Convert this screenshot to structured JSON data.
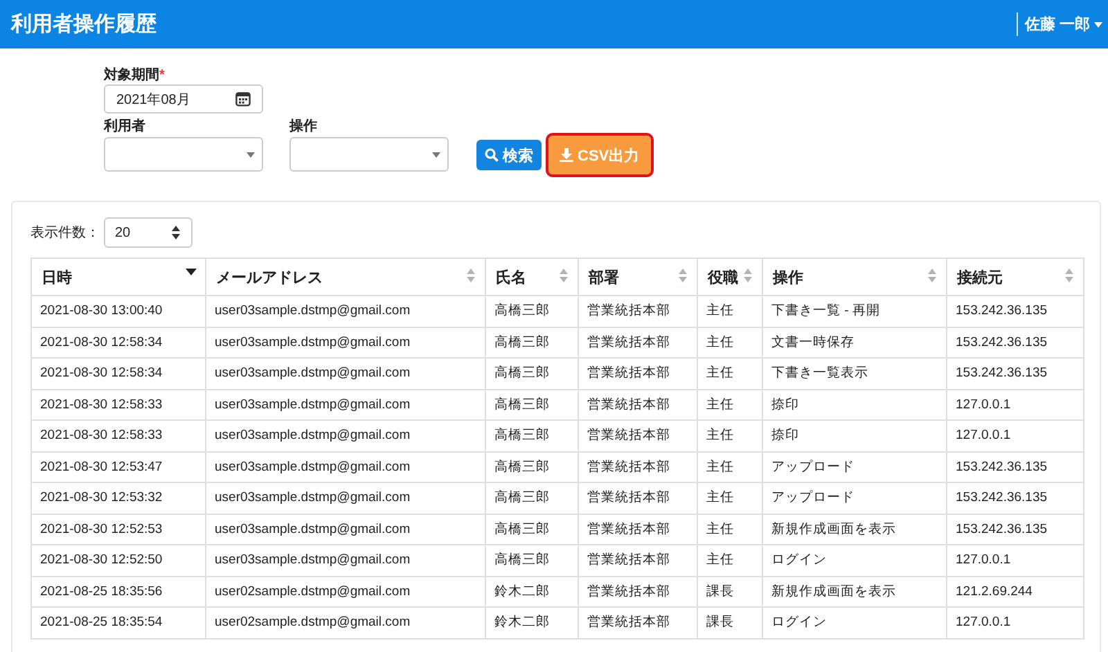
{
  "header": {
    "title": "利用者操作履歴",
    "user": "佐藤 一郎"
  },
  "filters": {
    "period": {
      "label": "対象期間",
      "required_mark": "*",
      "value": "2021年08月"
    },
    "user": {
      "label": "利用者"
    },
    "operation": {
      "label": "操作"
    },
    "buttons": [
      {
        "label": "検索",
        "kind": "search",
        "highlighted": false
      },
      {
        "label": "CSV出力",
        "kind": "download",
        "highlighted": true
      }
    ]
  },
  "page_size": {
    "label": "表示件数：",
    "value": "20"
  },
  "table": {
    "columns": [
      {
        "label": "日時",
        "sorted": true
      },
      {
        "label": "メールアドレス",
        "sorted": false
      },
      {
        "label": "氏名",
        "sorted": false
      },
      {
        "label": "部署",
        "sorted": false
      },
      {
        "label": "役職",
        "sorted": false
      },
      {
        "label": "操作",
        "sorted": false
      },
      {
        "label": "接続元",
        "sorted": false
      }
    ],
    "rows": [
      [
        "2021-08-30 13:00:40",
        "user03sample.dstmp@gmail.com",
        "高橋三郎",
        "営業統括本部",
        "主任",
        "下書き一覧 - 再開",
        "153.242.36.135"
      ],
      [
        "2021-08-30 12:58:34",
        "user03sample.dstmp@gmail.com",
        "高橋三郎",
        "営業統括本部",
        "主任",
        "文書一時保存",
        "153.242.36.135"
      ],
      [
        "2021-08-30 12:58:34",
        "user03sample.dstmp@gmail.com",
        "高橋三郎",
        "営業統括本部",
        "主任",
        "下書き一覧表示",
        "153.242.36.135"
      ],
      [
        "2021-08-30 12:58:33",
        "user03sample.dstmp@gmail.com",
        "高橋三郎",
        "営業統括本部",
        "主任",
        "捺印",
        "127.0.0.1"
      ],
      [
        "2021-08-30 12:58:33",
        "user03sample.dstmp@gmail.com",
        "高橋三郎",
        "営業統括本部",
        "主任",
        "捺印",
        "127.0.0.1"
      ],
      [
        "2021-08-30 12:53:47",
        "user03sample.dstmp@gmail.com",
        "高橋三郎",
        "営業統括本部",
        "主任",
        "アップロード",
        "153.242.36.135"
      ],
      [
        "2021-08-30 12:53:32",
        "user03sample.dstmp@gmail.com",
        "高橋三郎",
        "営業統括本部",
        "主任",
        "アップロード",
        "153.242.36.135"
      ],
      [
        "2021-08-30 12:52:53",
        "user03sample.dstmp@gmail.com",
        "高橋三郎",
        "営業統括本部",
        "主任",
        "新規作成画面を表示",
        "153.242.36.135"
      ],
      [
        "2021-08-30 12:52:50",
        "user03sample.dstmp@gmail.com",
        "高橋三郎",
        "営業統括本部",
        "主任",
        "ログイン",
        "127.0.0.1"
      ],
      [
        "2021-08-25 18:35:56",
        "user02sample.dstmp@gmail.com",
        "鈴木二郎",
        "営業統括本部",
        "課長",
        "新規作成画面を表示",
        "121.2.69.244"
      ],
      [
        "2021-08-25 18:35:54",
        "user02sample.dstmp@gmail.com",
        "鈴木二郎",
        "営業統括本部",
        "課長",
        "ログイン",
        "127.0.0.1"
      ]
    ]
  }
}
